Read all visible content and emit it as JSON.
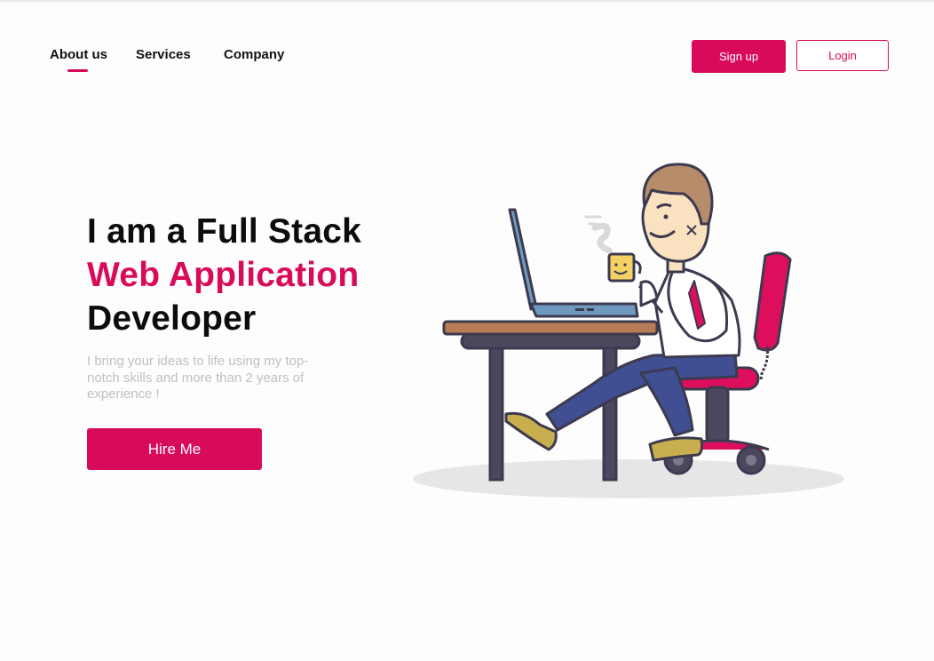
{
  "nav": {
    "items": [
      {
        "label": "About us",
        "active": true
      },
      {
        "label": "Services",
        "active": false
      },
      {
        "label": "Company",
        "active": false
      }
    ]
  },
  "auth": {
    "signup_label": "Sign up",
    "login_label": "Login"
  },
  "hero": {
    "title_line1": "I am a Full Stack",
    "title_line2": "Web Application",
    "title_line3": "Developer",
    "description": "I bring your ideas to life using my top-notch skills and more than 2 years of experience !",
    "cta_label": "Hire Me"
  },
  "colors": {
    "accent": "#d80b5b",
    "text": "#0c0c0c",
    "muted": "#c0c0c0",
    "background": "#fdfdfd"
  },
  "illustration": {
    "icon": "developer-at-desk-illustration"
  }
}
